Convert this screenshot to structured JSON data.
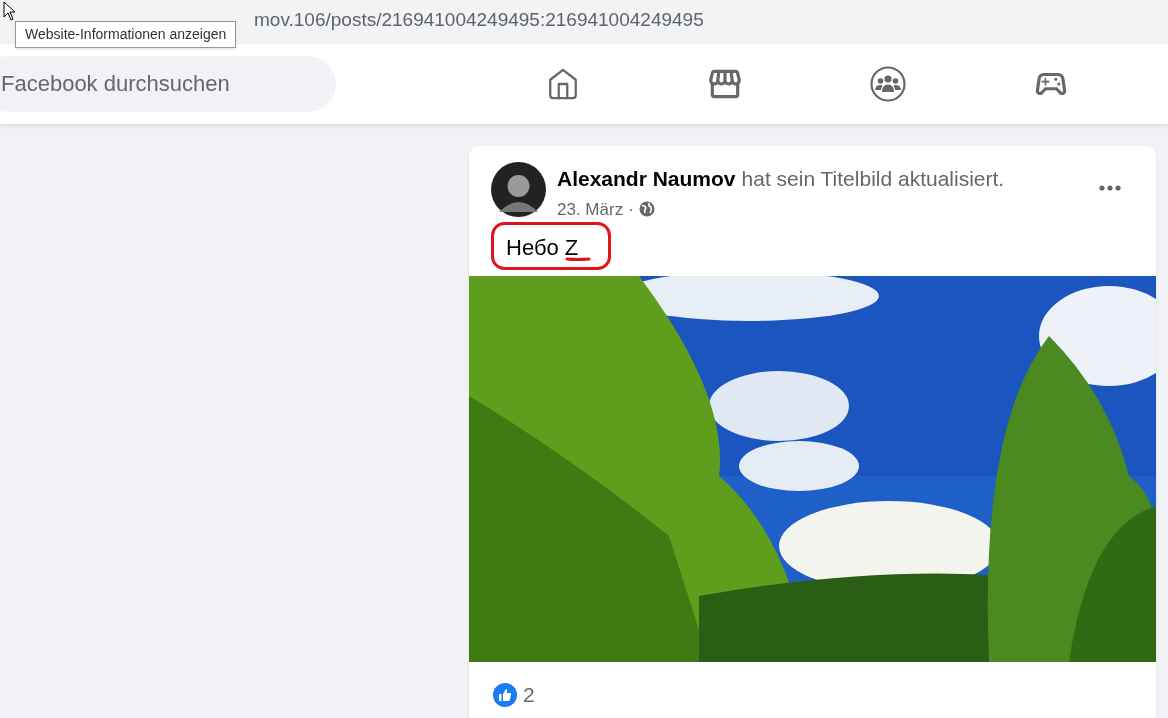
{
  "address_bar": {
    "url": "mov.106/posts/216941004249495:216941004249495",
    "tooltip": "Website-Informationen anzeigen"
  },
  "search": {
    "placeholder": "Facebook durchsuchen"
  },
  "nav": [
    {
      "kind": "home",
      "selected": false
    },
    {
      "kind": "store",
      "selected": false
    },
    {
      "kind": "groups",
      "selected": false
    },
    {
      "kind": "gaming",
      "selected": false
    }
  ],
  "post": {
    "author": "Alexandr Naumov",
    "action": "hat sein Titelbild aktualisiert.",
    "date": "23. März",
    "separator": "·",
    "text": "Небо Z",
    "highlighted": true,
    "reaction_count": "2"
  }
}
